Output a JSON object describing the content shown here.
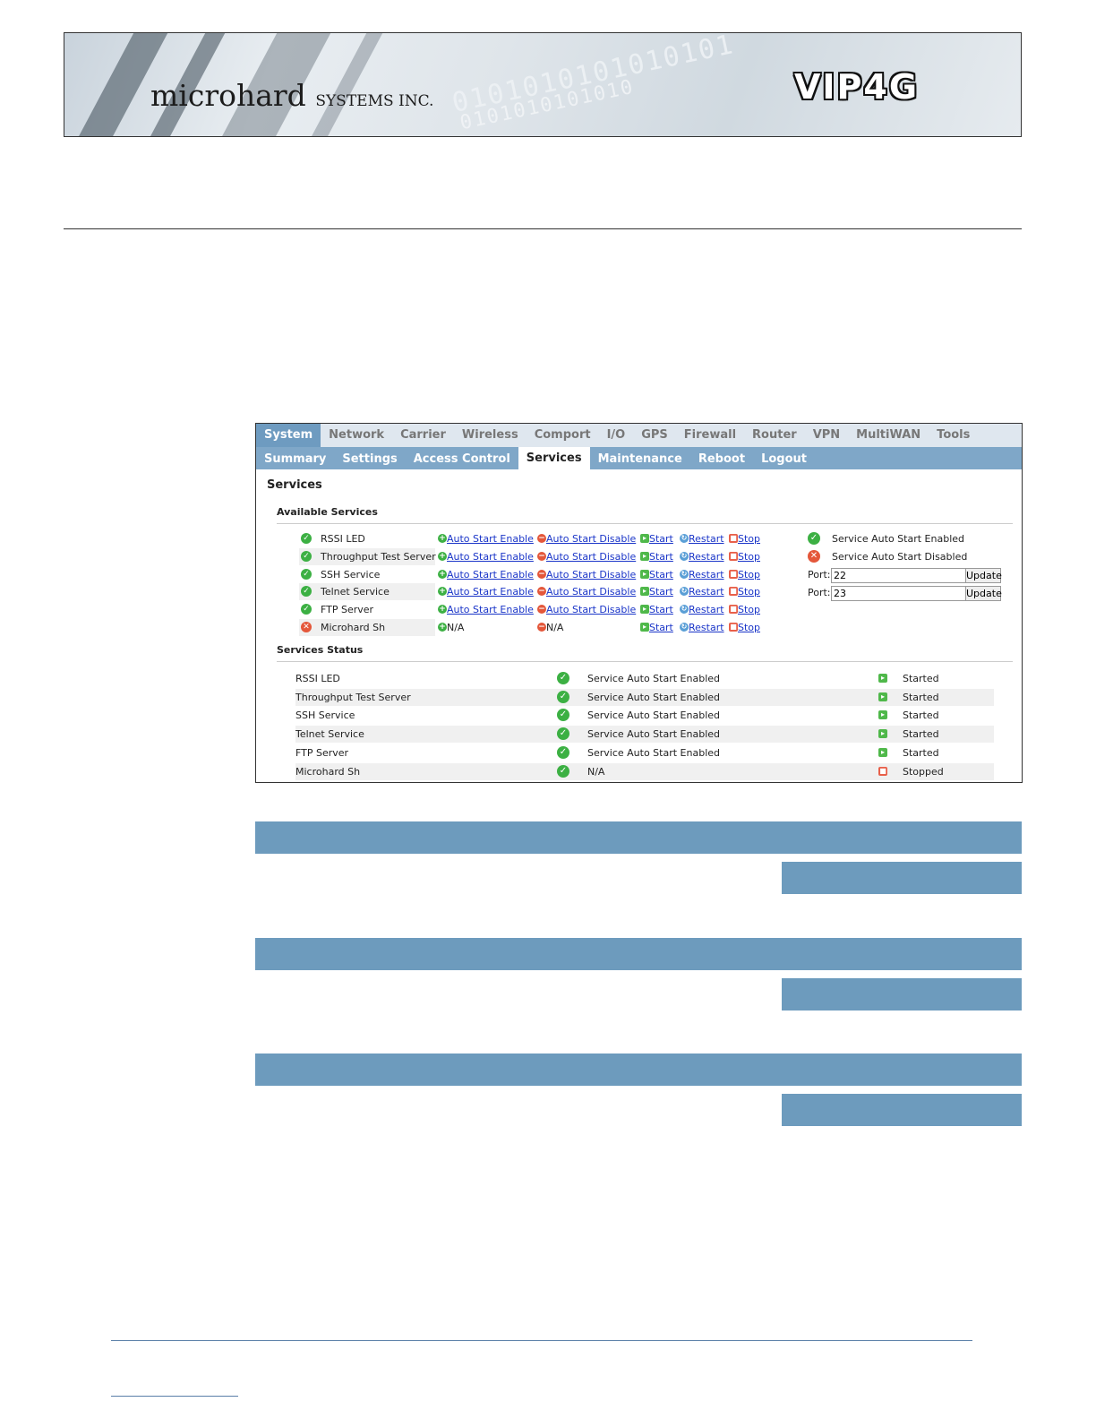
{
  "header": {
    "brand_main": "microhard",
    "brand_sub": "SYSTEMS INC.",
    "product": "VIP4G",
    "binary_1": "0101010101010101",
    "binary_2": "0101010101010"
  },
  "nav": {
    "main_tabs": [
      "System",
      "Network",
      "Carrier",
      "Wireless",
      "Comport",
      "I/O",
      "GPS",
      "Firewall",
      "Router",
      "VPN",
      "MultiWAN",
      "Tools"
    ],
    "sub_tabs": [
      "Summary",
      "Settings",
      "Access Control",
      "Services",
      "Maintenance",
      "Reboot",
      "Logout"
    ]
  },
  "page": {
    "title": "Services",
    "available_title": "Available Services",
    "status_title": "Services Status"
  },
  "actions": {
    "auto_enable": "Auto Start Enable",
    "auto_disable": "Auto Start Disable",
    "start": "Start",
    "restart": "Restart",
    "stop": "Stop",
    "na": "N/A"
  },
  "legend": {
    "enabled": "Service Auto Start Enabled",
    "disabled": "Service Auto Start Disabled"
  },
  "ports": {
    "label": "Port:",
    "ssh_value": "22",
    "telnet_value": "23",
    "update_label": "Update"
  },
  "available_services": [
    {
      "name": "RSSI LED",
      "status": "ok"
    },
    {
      "name": "Throughput Test Server",
      "status": "ok"
    },
    {
      "name": "SSH Service",
      "status": "ok"
    },
    {
      "name": "Telnet Service",
      "status": "ok"
    },
    {
      "name": "FTP Server",
      "status": "ok"
    },
    {
      "name": "Microhard Sh",
      "status": "err"
    }
  ],
  "services_status": [
    {
      "name": "RSSI LED",
      "auto": "Service Auto Start Enabled",
      "state": "Started"
    },
    {
      "name": "Throughput Test Server",
      "auto": "Service Auto Start Enabled",
      "state": "Started"
    },
    {
      "name": "SSH Service",
      "auto": "Service Auto Start Enabled",
      "state": "Started"
    },
    {
      "name": "Telnet Service",
      "auto": "Service Auto Start Enabled",
      "state": "Started"
    },
    {
      "name": "FTP Server",
      "auto": "Service Auto Start Enabled",
      "state": "Started"
    },
    {
      "name": "Microhard Sh",
      "auto": "N/A",
      "state": "Stopped"
    }
  ],
  "colors": {
    "nav_active": "#6e9bc0",
    "subnav_bg": "#7fa7c8",
    "bar_blue": "#6d9bbd",
    "ok_green": "#3cb043",
    "err_red": "#e4573a",
    "link_blue": "#1a35c8"
  }
}
